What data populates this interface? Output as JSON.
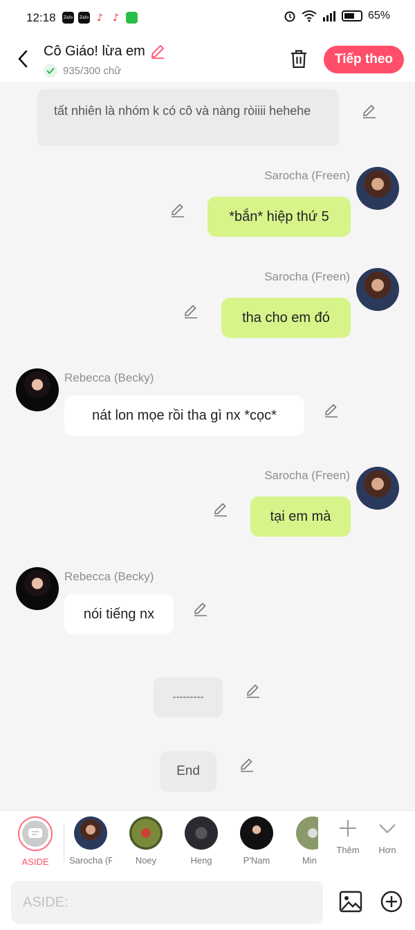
{
  "status": {
    "time": "12:18",
    "battery": "65%",
    "battery_level": 0.65
  },
  "header": {
    "title": "Cô Giáo! lừa em",
    "count": "935/300 chữ",
    "next_label": "Tiếp theo"
  },
  "messages": {
    "narr1": "tất nhiên là nhóm k có cô và nàng ròiiii hehehe",
    "m1_name": "Sarocha (Freen)",
    "m1_text": "*bắn* hiệp thứ 5",
    "m2_name": "Sarocha (Freen)",
    "m2_text": "tha cho em đó",
    "m3_name": "Rebecca (Becky)",
    "m3_text": "nát lon mọe rồi tha gì nx *cọc*",
    "m4_name": "Sarocha (Freen)",
    "m4_text": "tại em mà",
    "m5_name": "Rebecca (Becky)",
    "m5_text": "nói tiếng nx",
    "narr2": "---------",
    "narr3": "End"
  },
  "characters": [
    {
      "label": "ASIDE"
    },
    {
      "label": "Sarocha (F..."
    },
    {
      "label": "Noey"
    },
    {
      "label": "Heng"
    },
    {
      "label": "P'Nam"
    },
    {
      "label": "Min"
    }
  ],
  "tools": {
    "more_label": "Thêm",
    "expand_label": "Hơn"
  },
  "input": {
    "placeholder": "ASIDE:"
  },
  "colors": {
    "accent": "#ff4e6a",
    "right_bubble": "#d7f48b"
  }
}
